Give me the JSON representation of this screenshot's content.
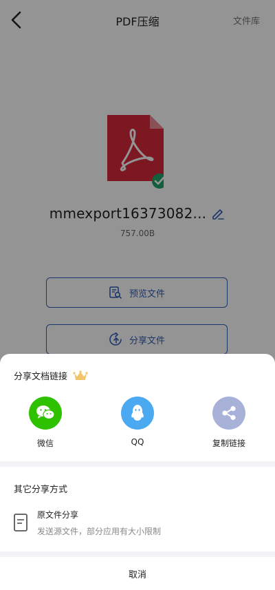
{
  "header": {
    "title": "PDF压缩",
    "right_link": "文件库"
  },
  "file": {
    "name": "mmexport16373082...",
    "size": "757.00B"
  },
  "actions": {
    "preview_label": "预览文件",
    "share_label": "分享文件"
  },
  "share_sheet": {
    "title": "分享文档链接",
    "options": [
      {
        "label": "微信",
        "icon": "wechat-icon",
        "color": "#2dc100"
      },
      {
        "label": "QQ",
        "icon": "qq-icon",
        "color": "#4aa9f0"
      },
      {
        "label": "复制链接",
        "icon": "share-link-icon",
        "color": "#a8b1d8"
      }
    ],
    "other_title": "其它分享方式",
    "original": {
      "title": "原文件分享",
      "desc": "发送源文件，部分应用有大小限制"
    },
    "cancel_label": "取消"
  },
  "colors": {
    "accent": "#2f5db8",
    "pdf_red": "#d8283a",
    "check_green": "#21a366",
    "overlay": "rgba(0,0,0,0.42)"
  }
}
